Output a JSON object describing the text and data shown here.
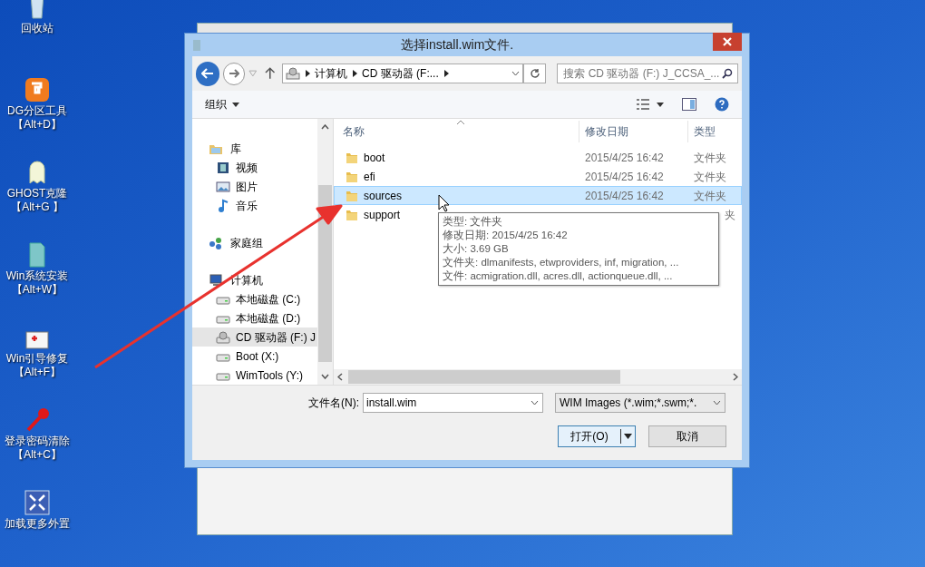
{
  "desktop_icons": [
    {
      "label": "回收站"
    },
    {
      "label": "DG分区工具",
      "shortcut": "【Alt+D】"
    },
    {
      "label": "GHOST克隆",
      "shortcut": "【Alt+G 】"
    },
    {
      "label": "Win系统安装",
      "shortcut": "【Alt+W】"
    },
    {
      "label": "Win引导修复",
      "shortcut": "【Alt+F】"
    },
    {
      "label": "登录密码清除",
      "shortcut": "【Alt+C】"
    },
    {
      "label": "加载更多外置"
    }
  ],
  "dialog": {
    "title": "选择install.wim文件.",
    "address": [
      "计算机",
      "CD 驱动器 (F:..."
    ],
    "search": {
      "placeholder": "搜索 CD 驱动器 (F:) J_CCSA_..."
    },
    "organize": "组织",
    "nav_tree": [
      {
        "label": "库",
        "selected": false,
        "children": [
          {
            "label": "视频",
            "selected": false
          },
          {
            "label": "图片",
            "selected": false
          },
          {
            "label": "音乐",
            "selected": false
          }
        ]
      },
      {
        "label": "家庭组",
        "selected": false
      },
      {
        "label": "计算机",
        "selected": false,
        "children": [
          {
            "label": "本地磁盘 (C:)",
            "selected": false
          },
          {
            "label": "本地磁盘 (D:)",
            "selected": false
          },
          {
            "label": "CD 驱动器 (F:) J",
            "selected": true
          },
          {
            "label": "Boot (X:)",
            "selected": false
          },
          {
            "label": "WimTools (Y:)",
            "selected": false
          }
        ]
      }
    ],
    "columns": [
      "名称",
      "修改日期",
      "类型"
    ],
    "rows": [
      {
        "name": "boot",
        "date": "2015/4/25 16:42",
        "type": "文件夹",
        "selected": false
      },
      {
        "name": "efi",
        "date": "2015/4/25 16:42",
        "type": "文件夹",
        "selected": false
      },
      {
        "name": "sources",
        "date": "2015/4/25 16:42",
        "type": "文件夹",
        "selected": true
      },
      {
        "name": "support",
        "type": "夹",
        "selected": false
      }
    ],
    "tooltip": [
      "类型: 文件夹",
      "修改日期: 2015/4/25 16:42",
      "大小: 3.69 GB",
      "文件夹: dlmanifests, etwproviders, inf, migration, ...",
      "文件: acmigration.dll, acres.dll, actionqueue.dll, ..."
    ],
    "filename_label": "文件名(N):",
    "filename": "install.wim",
    "filter": "WIM Images (*.wim;*.swm;*.",
    "buttons": [
      "打开(O)",
      "取消"
    ]
  }
}
